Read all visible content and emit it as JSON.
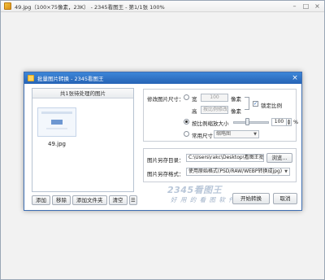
{
  "app": {
    "title": "49.jpg（100×75像素，23K） - 2345看图王 - 第1/1张 100%"
  },
  "dialog": {
    "title": "批量图片转换 - 2345看图王",
    "list_header": "共1张待处理的图片",
    "files": [
      {
        "name": "49.jpg"
      }
    ],
    "buttons": {
      "add": "添加",
      "remove": "移除",
      "add_folder": "添加文件夹",
      "clear": "清空"
    }
  },
  "size": {
    "label": "修改图片尺寸：",
    "width_label": "宽",
    "width_value": "100",
    "width_unit": "像素",
    "height_label": "高",
    "height_placeholder": "按比例修改",
    "height_unit": "像素",
    "lock_ratio_label": "锁定比例",
    "lock_ratio_checked": true,
    "scale_label": "按比例缩放大小",
    "scale_value": "100",
    "scale_unit": "%",
    "common_label": "常用尺寸",
    "common_value": "缩略图",
    "selected_option": "scale"
  },
  "save": {
    "dir_label": "图片另存目录：",
    "dir_value": "C:\\Users\\rakc\\Desktop\\看图王批",
    "browse_label": "浏览...",
    "format_label": "图片另存格式：",
    "format_value": "使用原始格式(PSD/RAW/WEBP转换成jpg)"
  },
  "brand": {
    "logo": "2345看图王",
    "slogan": "好 用 的 看 图 软 件 !"
  },
  "actions": {
    "convert": "开始转换",
    "cancel": "取消"
  }
}
